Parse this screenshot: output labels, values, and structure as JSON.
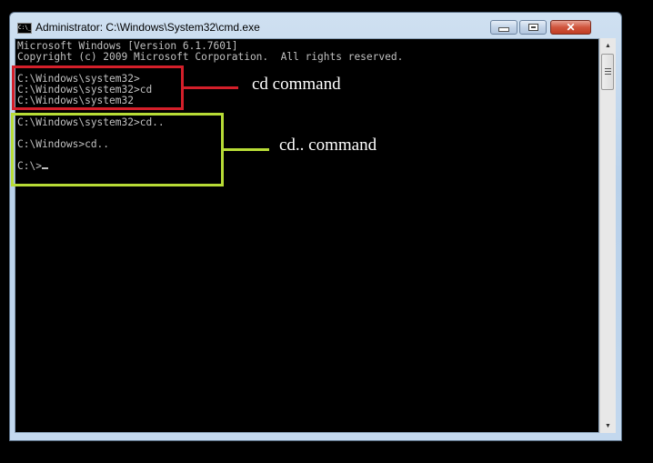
{
  "window": {
    "title": "Administrator: C:\\Windows\\System32\\cmd.exe",
    "icon": "cmd-icon",
    "icon_text": "C:\\_",
    "controls": {
      "minimize": "minimize-icon",
      "maximize": "maximize-icon",
      "close": "close-icon",
      "close_glyph": "✕"
    }
  },
  "console": {
    "lines": [
      "Microsoft Windows [Version 6.1.7601]",
      "Copyright (c) 2009 Microsoft Corporation.  All rights reserved.",
      "",
      "C:\\Windows\\system32>",
      "C:\\Windows\\system32>cd",
      "C:\\Windows\\system32",
      "",
      "C:\\Windows\\system32>cd..",
      "",
      "C:\\Windows>cd..",
      "",
      "C:\\>"
    ]
  },
  "scrollbar": {
    "up_arrow": "▲",
    "down_arrow": "▼",
    "position": 0
  },
  "annotations": {
    "red": {
      "label": "cd command",
      "color": "#d41f2a"
    },
    "green": {
      "label": "cd.. command",
      "color": "#b8dc36"
    }
  }
}
